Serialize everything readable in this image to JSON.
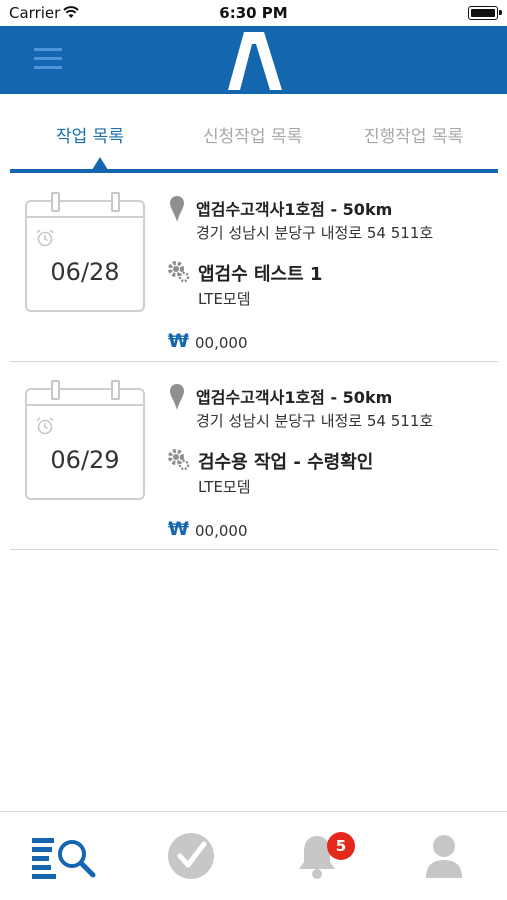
{
  "status_bar": {
    "carrier": "Carrier",
    "time": "6:30 PM"
  },
  "header": {
    "logo_letter": "A",
    "brand_color": "#1466ae"
  },
  "tabs": [
    {
      "label": "작업 목록",
      "active": true
    },
    {
      "label": "신청작업 목록",
      "active": false
    },
    {
      "label": "진행작업 목록",
      "active": false
    }
  ],
  "jobs": [
    {
      "date": "06/28",
      "store": "앱검수고객사1호점 - 50km",
      "address": "경기 성남시 분당구 내정로 54 511호",
      "title": "앱검수 테스트 1",
      "device": "LTE모뎀",
      "currency_symbol": "₩",
      "price": "00,000"
    },
    {
      "date": "06/29",
      "store": "앱검수고객사1호점 - 50km",
      "address": "경기 성남시 분당구 내정로 54 511호",
      "title": "검수용 작업 - 수령확인",
      "device": "LTE모뎀",
      "currency_symbol": "₩",
      "price": "00,000"
    }
  ],
  "bottom_nav": {
    "items": [
      {
        "icon": "list-search-icon",
        "active": true
      },
      {
        "icon": "check-circle-icon",
        "active": false
      },
      {
        "icon": "bell-icon",
        "active": false
      },
      {
        "icon": "user-icon",
        "active": false
      }
    ],
    "notification_count": "5"
  }
}
